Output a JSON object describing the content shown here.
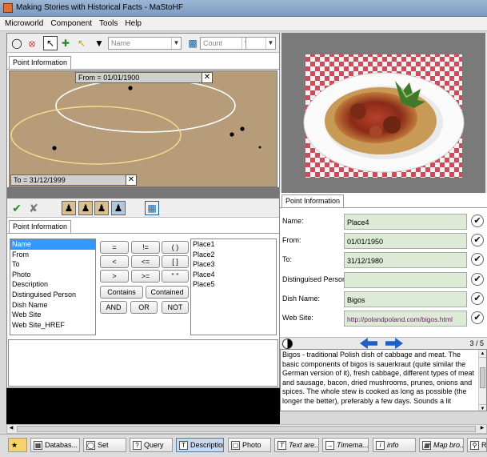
{
  "window": {
    "title": "Making Stories with Historical Facts - MaStoHF"
  },
  "menu": [
    "Microworld",
    "Component",
    "Tools",
    "Help"
  ],
  "toolbar": {
    "name_combo": "Name",
    "count_combo": "Count"
  },
  "timeline": {
    "tab": "Point Information",
    "from_label": "From = 01/01/1900",
    "to_label": "To = 31/12/1999"
  },
  "query": {
    "tab": "Point Information",
    "fields": [
      "Name",
      "From",
      "To",
      "Photo",
      "Description",
      "Distinguised Person",
      "Dish Name",
      "Web Site",
      "Web Site_HREF"
    ],
    "selected_field": "Name",
    "operators": [
      "=",
      "!=",
      "( )",
      "<",
      "<=",
      "[ ]",
      ">",
      ">=",
      "\" \""
    ],
    "contains_label": "Contains",
    "contained_label": "Contained",
    "and_label": "AND",
    "or_label": "OR",
    "not_label": "NOT",
    "places": [
      "Place1",
      "Place2",
      "Place3",
      "Place4",
      "Place5"
    ]
  },
  "details": {
    "tab": "Point Information",
    "fields": [
      {
        "label": "Name:",
        "value": "Place4"
      },
      {
        "label": "From:",
        "value": "01/01/1950"
      },
      {
        "label": "To:",
        "value": "31/12/1980"
      },
      {
        "label": "Distinguised Person:",
        "value": ""
      },
      {
        "label": "Dish Name:",
        "value": "Bigos"
      },
      {
        "label": "Web Site:",
        "value": "http://polandpoland.com/bigos.html"
      }
    ],
    "page": "3 / 5",
    "description": "Bigos - traditional Polish dish of cabbage and meat. The basic components of bigos is sauerkraut (quite similar the German version of it), fresh cabbage, different types of meat and sausage, bacon, dried mushrooms, prunes, onions and spices. The whole stew is cooked as long as possible (the longer the better), preferably a few days. Sounds a lit"
  },
  "taskbar": [
    {
      "label": "Databas..."
    },
    {
      "label": "Set"
    },
    {
      "label": "Query"
    },
    {
      "label": "Description"
    },
    {
      "label": "Photo"
    },
    {
      "label": "Text are..."
    },
    {
      "label": "Timema..."
    },
    {
      "label": "info"
    },
    {
      "label": "Map bro..."
    },
    {
      "label": "Re"
    }
  ],
  "colors": {
    "accent": "#3399ff",
    "field_bg": "#ddebd6",
    "canvas": "#b79c7a",
    "link": "#6a1b6a"
  }
}
